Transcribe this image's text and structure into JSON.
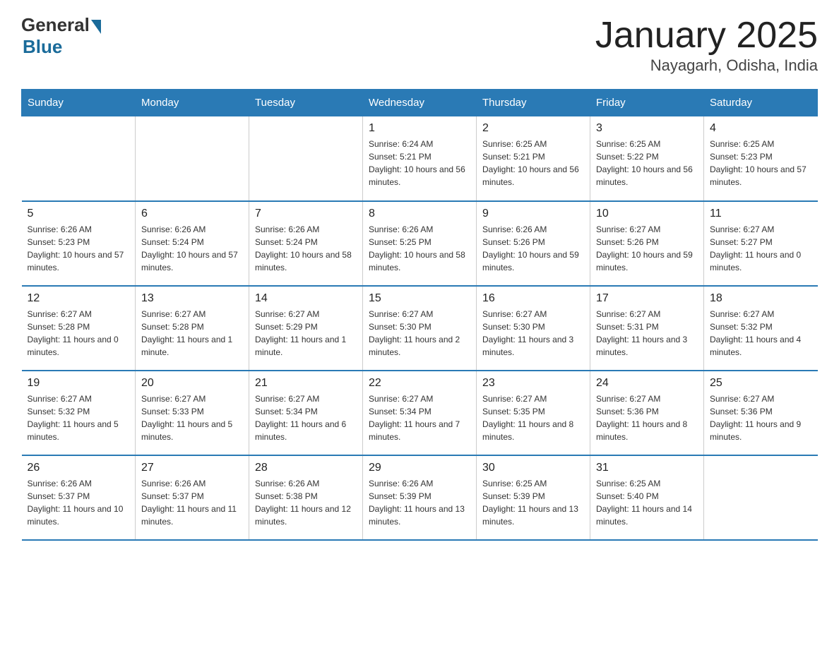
{
  "logo": {
    "general": "General",
    "blue": "Blue"
  },
  "title": "January 2025",
  "subtitle": "Nayagarh, Odisha, India",
  "days_header": [
    "Sunday",
    "Monday",
    "Tuesday",
    "Wednesday",
    "Thursday",
    "Friday",
    "Saturday"
  ],
  "weeks": [
    [
      {
        "day": "",
        "info": ""
      },
      {
        "day": "",
        "info": ""
      },
      {
        "day": "",
        "info": ""
      },
      {
        "day": "1",
        "info": "Sunrise: 6:24 AM\nSunset: 5:21 PM\nDaylight: 10 hours and 56 minutes."
      },
      {
        "day": "2",
        "info": "Sunrise: 6:25 AM\nSunset: 5:21 PM\nDaylight: 10 hours and 56 minutes."
      },
      {
        "day": "3",
        "info": "Sunrise: 6:25 AM\nSunset: 5:22 PM\nDaylight: 10 hours and 56 minutes."
      },
      {
        "day": "4",
        "info": "Sunrise: 6:25 AM\nSunset: 5:23 PM\nDaylight: 10 hours and 57 minutes."
      }
    ],
    [
      {
        "day": "5",
        "info": "Sunrise: 6:26 AM\nSunset: 5:23 PM\nDaylight: 10 hours and 57 minutes."
      },
      {
        "day": "6",
        "info": "Sunrise: 6:26 AM\nSunset: 5:24 PM\nDaylight: 10 hours and 57 minutes."
      },
      {
        "day": "7",
        "info": "Sunrise: 6:26 AM\nSunset: 5:24 PM\nDaylight: 10 hours and 58 minutes."
      },
      {
        "day": "8",
        "info": "Sunrise: 6:26 AM\nSunset: 5:25 PM\nDaylight: 10 hours and 58 minutes."
      },
      {
        "day": "9",
        "info": "Sunrise: 6:26 AM\nSunset: 5:26 PM\nDaylight: 10 hours and 59 minutes."
      },
      {
        "day": "10",
        "info": "Sunrise: 6:27 AM\nSunset: 5:26 PM\nDaylight: 10 hours and 59 minutes."
      },
      {
        "day": "11",
        "info": "Sunrise: 6:27 AM\nSunset: 5:27 PM\nDaylight: 11 hours and 0 minutes."
      }
    ],
    [
      {
        "day": "12",
        "info": "Sunrise: 6:27 AM\nSunset: 5:28 PM\nDaylight: 11 hours and 0 minutes."
      },
      {
        "day": "13",
        "info": "Sunrise: 6:27 AM\nSunset: 5:28 PM\nDaylight: 11 hours and 1 minute."
      },
      {
        "day": "14",
        "info": "Sunrise: 6:27 AM\nSunset: 5:29 PM\nDaylight: 11 hours and 1 minute."
      },
      {
        "day": "15",
        "info": "Sunrise: 6:27 AM\nSunset: 5:30 PM\nDaylight: 11 hours and 2 minutes."
      },
      {
        "day": "16",
        "info": "Sunrise: 6:27 AM\nSunset: 5:30 PM\nDaylight: 11 hours and 3 minutes."
      },
      {
        "day": "17",
        "info": "Sunrise: 6:27 AM\nSunset: 5:31 PM\nDaylight: 11 hours and 3 minutes."
      },
      {
        "day": "18",
        "info": "Sunrise: 6:27 AM\nSunset: 5:32 PM\nDaylight: 11 hours and 4 minutes."
      }
    ],
    [
      {
        "day": "19",
        "info": "Sunrise: 6:27 AM\nSunset: 5:32 PM\nDaylight: 11 hours and 5 minutes."
      },
      {
        "day": "20",
        "info": "Sunrise: 6:27 AM\nSunset: 5:33 PM\nDaylight: 11 hours and 5 minutes."
      },
      {
        "day": "21",
        "info": "Sunrise: 6:27 AM\nSunset: 5:34 PM\nDaylight: 11 hours and 6 minutes."
      },
      {
        "day": "22",
        "info": "Sunrise: 6:27 AM\nSunset: 5:34 PM\nDaylight: 11 hours and 7 minutes."
      },
      {
        "day": "23",
        "info": "Sunrise: 6:27 AM\nSunset: 5:35 PM\nDaylight: 11 hours and 8 minutes."
      },
      {
        "day": "24",
        "info": "Sunrise: 6:27 AM\nSunset: 5:36 PM\nDaylight: 11 hours and 8 minutes."
      },
      {
        "day": "25",
        "info": "Sunrise: 6:27 AM\nSunset: 5:36 PM\nDaylight: 11 hours and 9 minutes."
      }
    ],
    [
      {
        "day": "26",
        "info": "Sunrise: 6:26 AM\nSunset: 5:37 PM\nDaylight: 11 hours and 10 minutes."
      },
      {
        "day": "27",
        "info": "Sunrise: 6:26 AM\nSunset: 5:37 PM\nDaylight: 11 hours and 11 minutes."
      },
      {
        "day": "28",
        "info": "Sunrise: 6:26 AM\nSunset: 5:38 PM\nDaylight: 11 hours and 12 minutes."
      },
      {
        "day": "29",
        "info": "Sunrise: 6:26 AM\nSunset: 5:39 PM\nDaylight: 11 hours and 13 minutes."
      },
      {
        "day": "30",
        "info": "Sunrise: 6:25 AM\nSunset: 5:39 PM\nDaylight: 11 hours and 13 minutes."
      },
      {
        "day": "31",
        "info": "Sunrise: 6:25 AM\nSunset: 5:40 PM\nDaylight: 11 hours and 14 minutes."
      },
      {
        "day": "",
        "info": ""
      }
    ]
  ]
}
